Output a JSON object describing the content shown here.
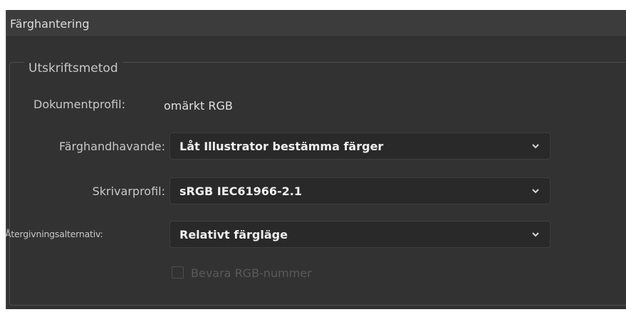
{
  "panel": {
    "title": "Färghantering"
  },
  "print_method": {
    "legend": "Utskriftsmetod",
    "document_profile": {
      "label": "Dokumentprofil:",
      "value": "omärkt RGB"
    },
    "color_handling": {
      "label": "Färghandhavande:",
      "selected": "Låt Illustrator bestämma färger"
    },
    "printer_profile": {
      "label": "Skrivarprofil:",
      "selected": "sRGB IEC61966-2.1"
    },
    "rendering_intent": {
      "label": "Återgivningsalternativ:",
      "selected": "Relativt färgläge"
    },
    "preserve_rgb": {
      "label": "Bevara RGB-nummer",
      "checked": false,
      "disabled": true
    }
  },
  "icons": {
    "dropdown": "chevron-down-icon"
  }
}
